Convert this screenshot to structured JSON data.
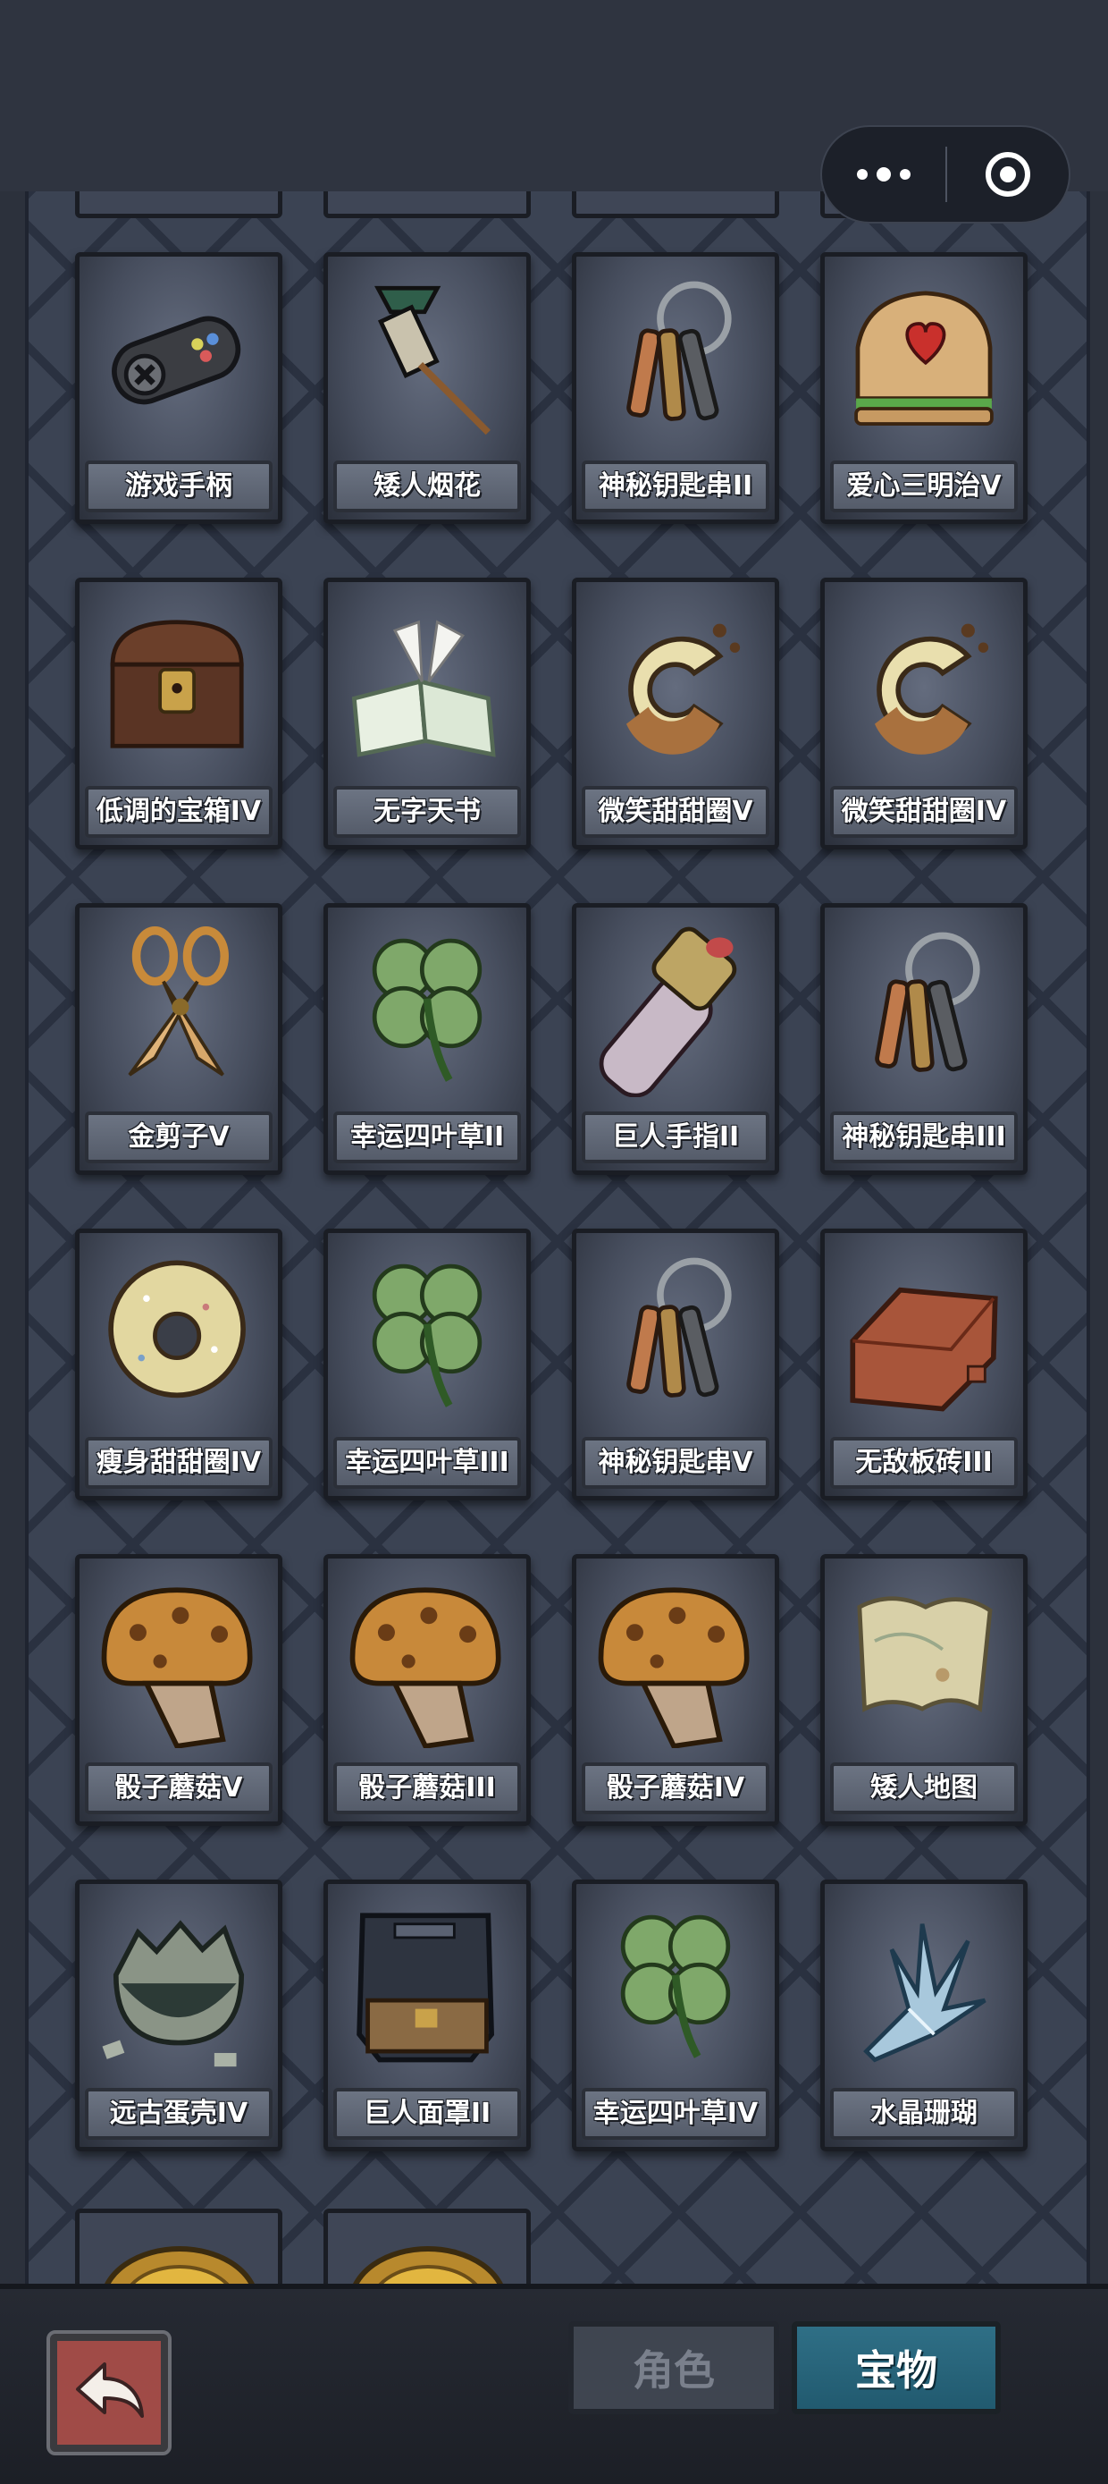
{
  "header": {
    "more_icon": "more-dots-icon",
    "close_icon": "target-close-icon"
  },
  "items": [
    {
      "label": "游戏手柄",
      "icon": "gamepad-icon"
    },
    {
      "label": "矮人烟花",
      "icon": "firework-rocket-icon"
    },
    {
      "label": "神秘钥匙串II",
      "icon": "key-ring-icon"
    },
    {
      "label": "爱心三明治V",
      "icon": "heart-sandwich-icon"
    },
    {
      "label": "低调的宝箱IV",
      "icon": "treasure-chest-icon"
    },
    {
      "label": "无字天书",
      "icon": "blank-book-icon"
    },
    {
      "label": "微笑甜甜圈V",
      "icon": "smile-donut-icon"
    },
    {
      "label": "微笑甜甜圈IV",
      "icon": "smile-donut-icon"
    },
    {
      "label": "金剪子V",
      "icon": "golden-scissors-icon"
    },
    {
      "label": "幸运四叶草II",
      "icon": "four-leaf-clover-icon"
    },
    {
      "label": "巨人手指II",
      "icon": "giant-finger-icon"
    },
    {
      "label": "神秘钥匙串III",
      "icon": "key-ring-icon"
    },
    {
      "label": "瘦身甜甜圈IV",
      "icon": "frosted-donut-icon"
    },
    {
      "label": "幸运四叶草III",
      "icon": "four-leaf-clover-icon"
    },
    {
      "label": "神秘钥匙串V",
      "icon": "key-ring-icon"
    },
    {
      "label": "无敌板砖III",
      "icon": "brick-icon"
    },
    {
      "label": "骰子蘑菇V",
      "icon": "dice-mushroom-icon"
    },
    {
      "label": "骰子蘑菇III",
      "icon": "dice-mushroom-icon"
    },
    {
      "label": "骰子蘑菇IV",
      "icon": "dice-mushroom-icon"
    },
    {
      "label": "矮人地图",
      "icon": "scroll-map-icon"
    },
    {
      "label": "远古蛋壳IV",
      "icon": "eggshell-icon"
    },
    {
      "label": "巨人面罩II",
      "icon": "giant-mask-icon"
    },
    {
      "label": "幸运四叶草IV",
      "icon": "four-leaf-clover-icon"
    },
    {
      "label": "水晶珊瑚",
      "icon": "crystal-coral-icon"
    }
  ],
  "partial_bottom_icons": [
    "gold-coin-icon",
    "gold-coin-icon"
  ],
  "bottom_nav": {
    "back_icon": "back-arrow-icon",
    "tab_roles": "角色",
    "tab_treasure": "宝物",
    "active_tab": "宝物"
  }
}
